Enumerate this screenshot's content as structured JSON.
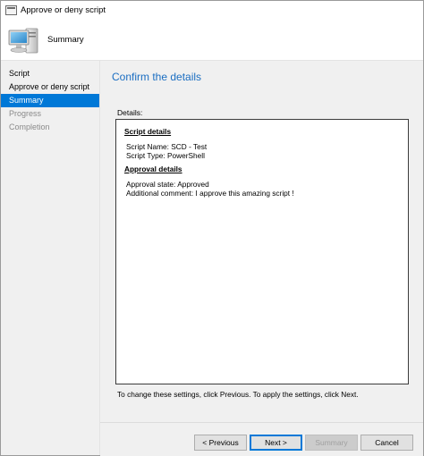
{
  "window": {
    "title": "Approve or deny script"
  },
  "header": {
    "title": "Summary",
    "icon": "computer-monitor-icon"
  },
  "sidebar": {
    "items": [
      {
        "label": "Script",
        "state": "normal"
      },
      {
        "label": "Approve or deny script",
        "state": "normal"
      },
      {
        "label": "Summary",
        "state": "active"
      },
      {
        "label": "Progress",
        "state": "disabled"
      },
      {
        "label": "Completion",
        "state": "disabled"
      }
    ]
  },
  "main": {
    "page_title": "Confirm the details",
    "details_label": "Details:",
    "details": {
      "script_section": "Script details",
      "script_name": "Script Name: SCD - Test",
      "script_type": "Script Type: PowerShell",
      "approval_section": "Approval details",
      "approval_state": "Approval state: Approved",
      "additional_comment": "Additional comment: I approve this amazing script !"
    },
    "hint": "To change these settings, click Previous. To apply the settings, click Next."
  },
  "buttons": {
    "previous": "< Previous",
    "next": "Next >",
    "summary": "Summary",
    "cancel": "Cancel"
  },
  "colors": {
    "accent": "#0078d7",
    "title_blue": "#1b6ec2",
    "panel": "#f0f0f0"
  }
}
